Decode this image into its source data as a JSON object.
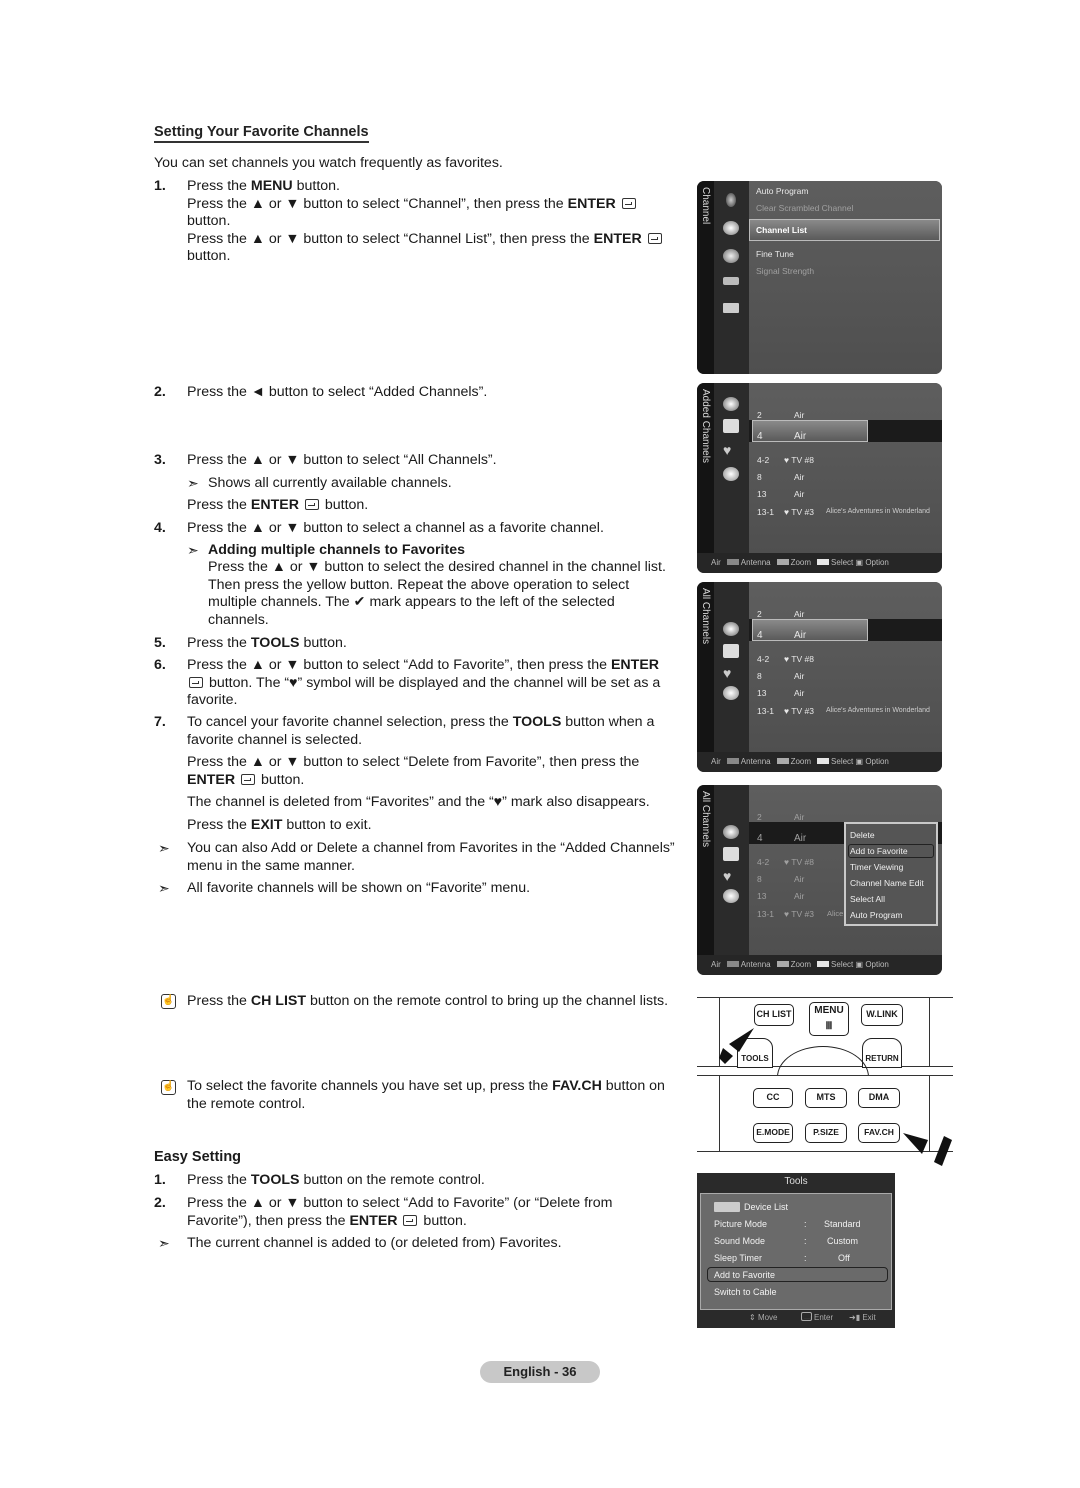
{
  "section": {
    "title": "Setting Your Favorite Channels",
    "intro": "You can set channels you watch frequently as favorites."
  },
  "steps": {
    "s1": {
      "num": "1.",
      "l1a": "Press the ",
      "l1b": "MENU",
      "l1c": " button.",
      "l2a": "Press the ▲ or ▼ button to select “Channel”, then press the ",
      "l2b": "ENTER",
      "l2c": "button.",
      "l3a": "Press the ▲ or ▼ button to select “Channel List”, then press the ",
      "l3b": "ENTER",
      "l3c": " button."
    },
    "s2": {
      "num": "2.",
      "text": "Press the ◄ button to select “Added Channels”."
    },
    "s3": {
      "num": "3.",
      "text": "Press the ▲ or ▼ button to select “All Channels”.",
      "note": "Shows all currently available channels.",
      "l3a": "Press the ",
      "l3b": "ENTER",
      "l3c": " button."
    },
    "s4": {
      "num": "4.",
      "text": "Press the ▲ or ▼ button to select a channel as a favorite channel.",
      "sub_title": "Adding multiple channels to Favorites",
      "sub_text_a": "Press the ▲ or ▼ button to select the desired channel in the channel list. Then press the yellow button. Repeat the above operation to select multiple channels. The ",
      "check": "✔",
      "sub_text_b": "mark appears to the left of the selected channels."
    },
    "s5": {
      "num": "5.",
      "a": "Press the ",
      "b": "TOOLS",
      "c": " button."
    },
    "s6": {
      "num": "6.",
      "a": "Press the ▲ or ▼ button to select “Add to Favorite”, then press the ",
      "b": "ENTER",
      "c": " button. The “♥” symbol will be displayed and the channel will be set as a favorite."
    },
    "s7": {
      "num": "7.",
      "a": "To cancel your favorite channel selection, press the ",
      "b": "TOOLS",
      "c": " button when a favorite channel is selected.",
      "p2a": "Press the ▲ or ▼ button to select “Delete from Favorite”, then press the ",
      "p2b": "ENTER",
      "p2c": " button.",
      "p3": "The channel is deleted from “Favorites” and the “♥” mark also disappears.",
      "p4a": "Press the ",
      "p4b": "EXIT",
      "p4c": " button to exit."
    }
  },
  "notes": {
    "arrow": "➣",
    "n1": "You can also Add or Delete a channel from Favorites in the “Added Channels” menu in the same manner.",
    "n2": "All favorite channels will be shown on “Favorite” menu."
  },
  "remote_notes": {
    "icon": "☝",
    "r1a": "Press the ",
    "r1b": "CH LIST",
    "r1c": " button on the remote control to bring up the channel lists.",
    "r2a": "To select the favorite channels you have set up, press the ",
    "r2b": "FAV.CH",
    "r2c": " button on the remote control."
  },
  "easy": {
    "title": "Easy Setting",
    "s1": {
      "num": "1.",
      "a": "Press the ",
      "b": "TOOLS",
      "c": " button on the remote control."
    },
    "s2": {
      "num": "2.",
      "a": "Press the ▲ or ▼ button to select “Add to Favorite” (or “Delete from Favorite”), then press the ",
      "b": "ENTER",
      "c": " button."
    },
    "note": "The current channel is added to (or deleted from) Favorites."
  },
  "menu_panel": {
    "tab": "Channel",
    "items": [
      "Auto Program",
      "Clear Scrambled Channel",
      "Channel List",
      "Fine Tune",
      "Signal Strength"
    ],
    "selected": "Channel List"
  },
  "channel_panels": [
    {
      "tab": "Added Channels"
    },
    {
      "tab": "All Channels"
    },
    {
      "tab": "All Channels"
    }
  ],
  "channels": [
    {
      "num": "2",
      "name": "Air",
      "program": ""
    },
    {
      "num": "4",
      "name": "Air",
      "program": ""
    },
    {
      "num": "4-2",
      "name": "♥ TV #8",
      "program": ""
    },
    {
      "num": "8",
      "name": "Air",
      "program": ""
    },
    {
      "num": "13",
      "name": "Air",
      "program": ""
    },
    {
      "num": "13-1",
      "name": "♥ TV #3",
      "program": "Alice's Adventures in Wonderland"
    }
  ],
  "channel_footer": {
    "source": "Air",
    "antenna": "Antenna",
    "zoom": "Zoom",
    "select": "Select",
    "option": "Option",
    "colors": {
      "antenna": "#888888",
      "zoom": "#aaaaaa",
      "select": "#e6e6e6"
    }
  },
  "context_menu": {
    "items": [
      "Delete",
      "Add to Favorite",
      "Timer Viewing",
      "Channel Name Edit",
      "Select All",
      "Auto Program"
    ],
    "selected": "Add to Favorite",
    "truncated_program": "Alice"
  },
  "remote": {
    "top_buttons": [
      "CH LIST",
      "MENU",
      "W.LINK"
    ],
    "arc_labels": [
      "TOOLS",
      "RETURN"
    ],
    "bottom_row1": [
      "CC",
      "MTS",
      "DMA"
    ],
    "bottom_row2": [
      "E.MODE",
      "P.SIZE",
      "FAV.CH"
    ]
  },
  "tools_panel": {
    "title": "Tools",
    "device_list": "Device List",
    "rows": [
      {
        "label": "Picture Mode",
        "sep": ":",
        "value": "Standard"
      },
      {
        "label": "Sound Mode",
        "sep": ":",
        "value": "Custom"
      },
      {
        "label": "Sleep Timer",
        "sep": ":",
        "value": "Off"
      }
    ],
    "add_favorite": "Add to Favorite",
    "switch_cable": "Switch to Cable",
    "footer": {
      "move": "Move",
      "enter": "Enter",
      "exit": "Exit"
    }
  },
  "page": {
    "label": "English - 36"
  }
}
